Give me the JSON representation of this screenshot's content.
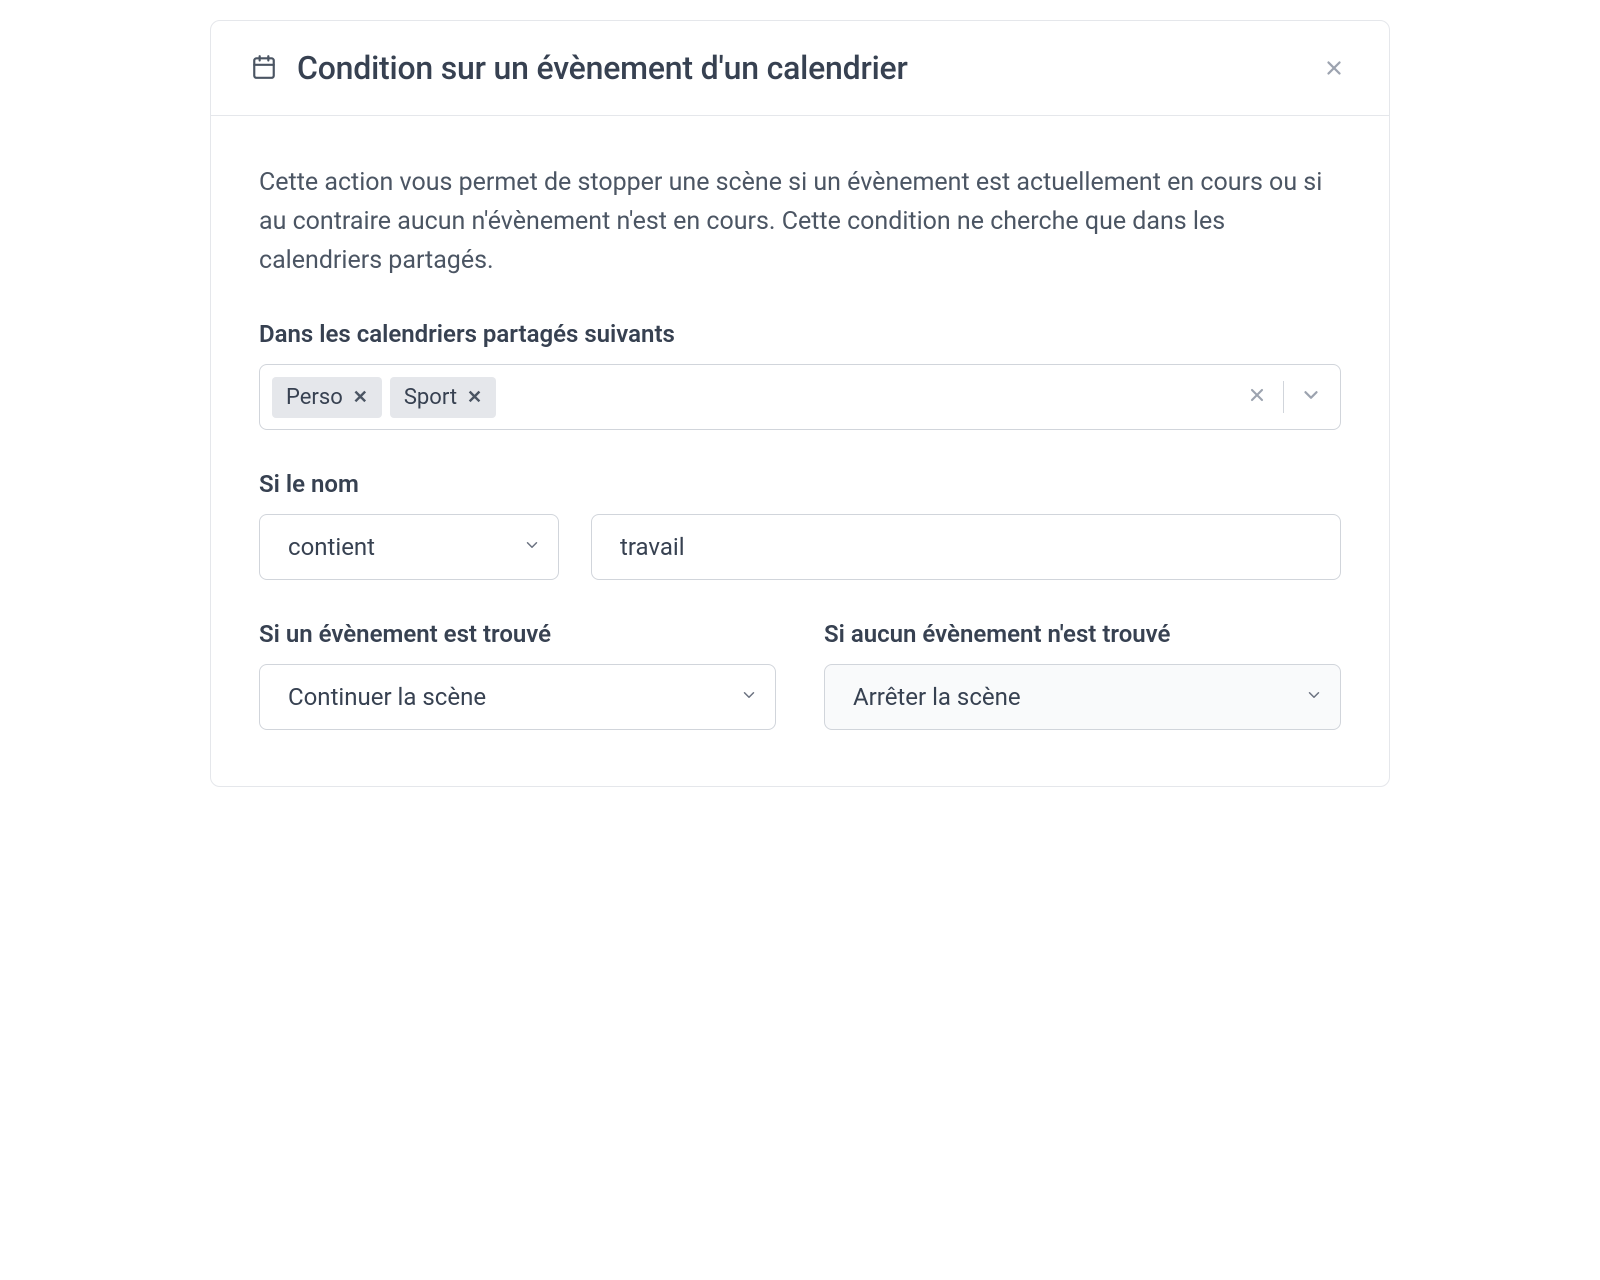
{
  "header": {
    "title": "Condition sur un évènement d'un calendrier"
  },
  "description": "Cette action vous permet de stopper une scène si un évènement est actuellement en cours ou si au contraire aucun n'évènement n'est en cours. Cette condition ne cherche que dans les calendriers partagés.",
  "calendars": {
    "label": "Dans les calendriers partagés suivants",
    "tags": [
      "Perso",
      "Sport"
    ]
  },
  "name_filter": {
    "label": "Si le nom",
    "operator": "contient",
    "value": "travail"
  },
  "event_found": {
    "label": "Si un évènement est trouvé",
    "value": "Continuer la scène"
  },
  "no_event_found": {
    "label": "Si aucun évènement n'est trouvé",
    "value": "Arrêter la scène"
  }
}
